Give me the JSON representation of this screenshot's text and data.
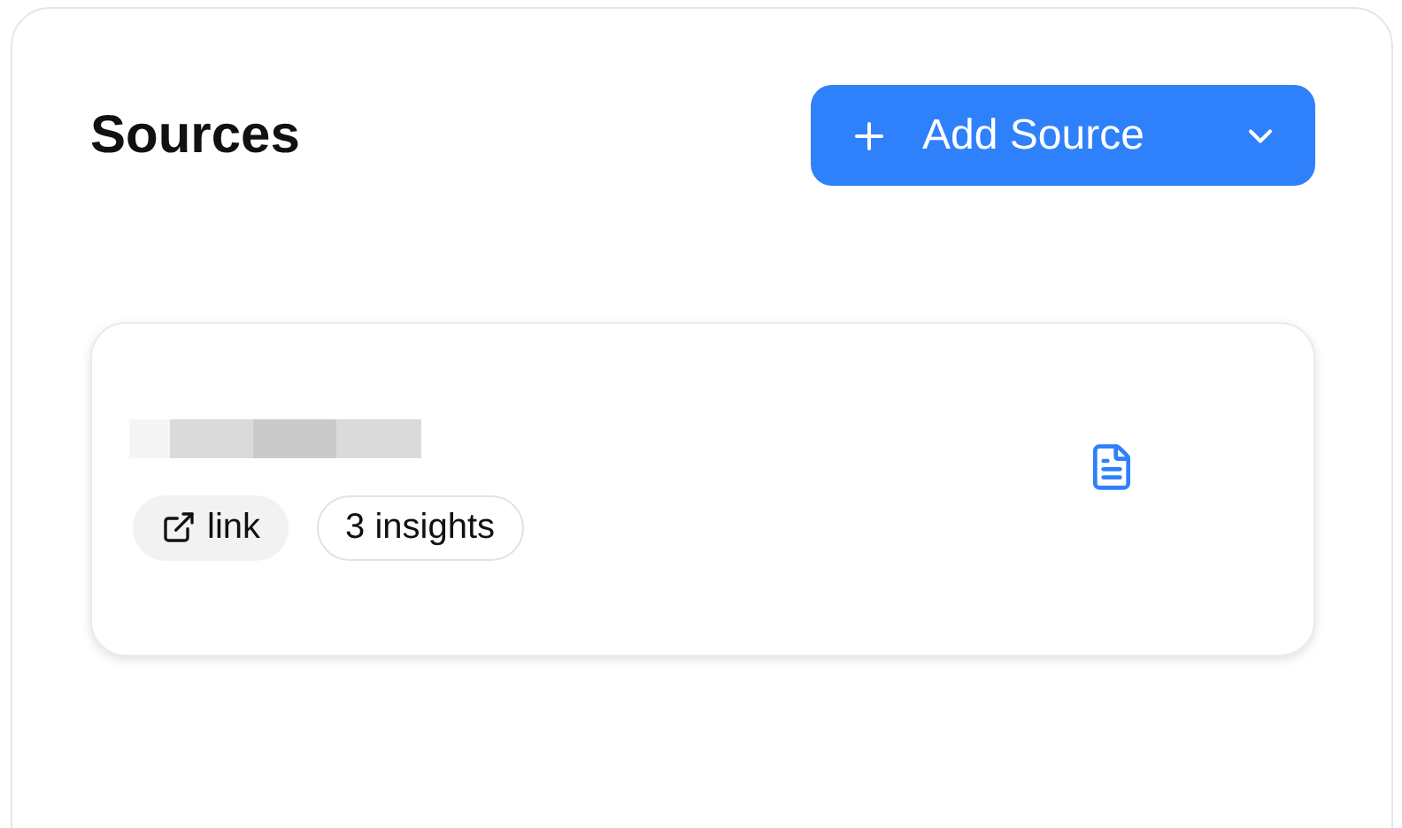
{
  "header": {
    "title": "Sources",
    "add_button": {
      "label": "Add Source"
    }
  },
  "sources": [
    {
      "kind": "link",
      "tags": [
        {
          "kind": "link",
          "label": "link"
        },
        {
          "kind": "count",
          "label": "3 insights"
        }
      ]
    }
  ]
}
